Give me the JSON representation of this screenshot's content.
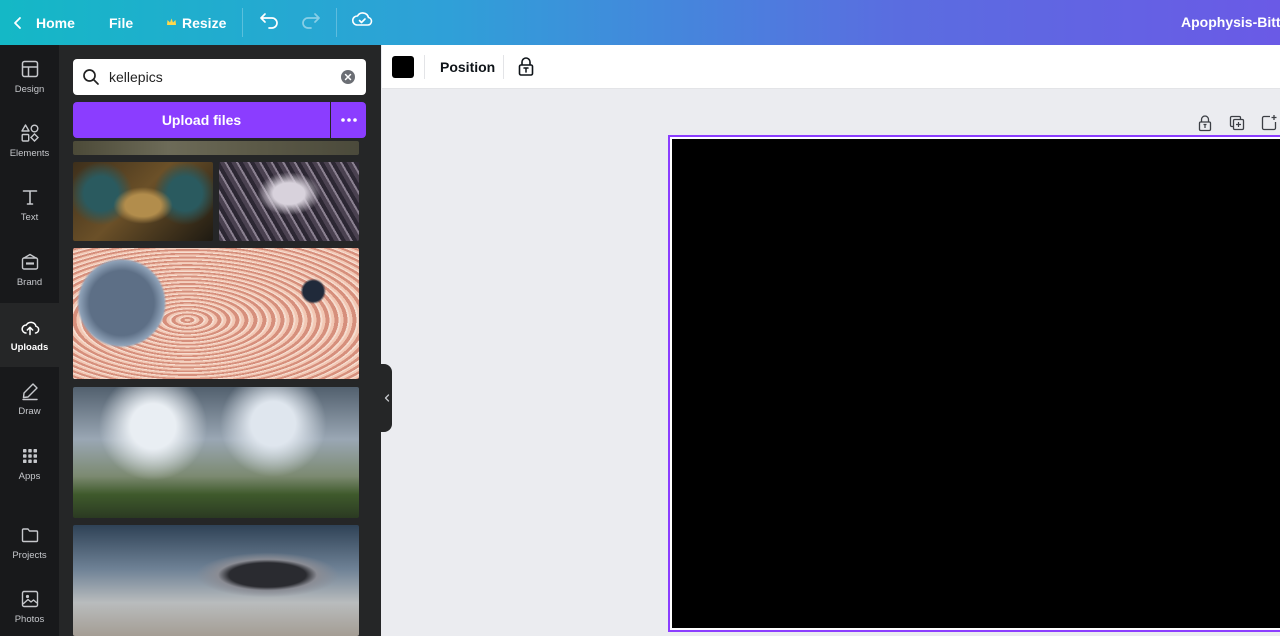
{
  "topbar": {
    "home_label": "Home",
    "file_label": "File",
    "resize_label": "Resize",
    "title": "Apophysis-Bitter"
  },
  "rail": {
    "items": [
      {
        "label": "Design",
        "icon": "layout-icon"
      },
      {
        "label": "Elements",
        "icon": "shapes-icon"
      },
      {
        "label": "Text",
        "icon": "text-icon"
      },
      {
        "label": "Brand",
        "icon": "brand-icon"
      },
      {
        "label": "Uploads",
        "icon": "cloud-upload-icon"
      },
      {
        "label": "Draw",
        "icon": "pen-icon"
      },
      {
        "label": "Apps",
        "icon": "apps-grid-icon"
      },
      {
        "label": "Projects",
        "icon": "folder-icon"
      },
      {
        "label": "Photos",
        "icon": "image-icon"
      }
    ],
    "active": "Uploads"
  },
  "panel": {
    "search": {
      "value": "kellepics"
    },
    "upload_label": "Upload files"
  },
  "toolbar": {
    "color": "#000000",
    "position_label": "Position"
  },
  "colors": {
    "accent": "#8b3dff",
    "rail_bg": "#18191b",
    "panel_bg": "#252627"
  }
}
